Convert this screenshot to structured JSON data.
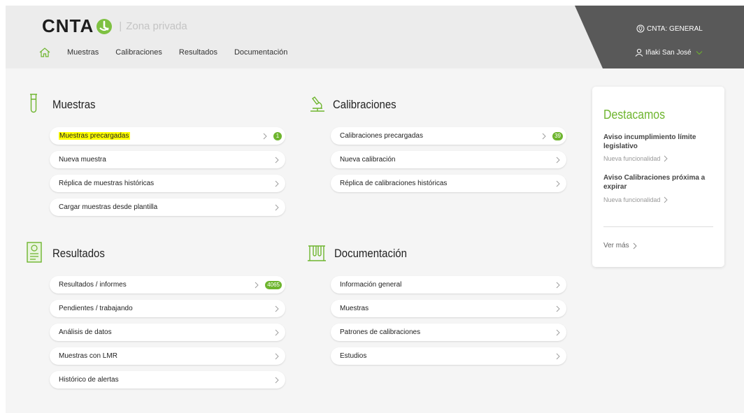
{
  "header": {
    "logo_text": "CNTA",
    "logo_separator": "|",
    "zone": "Zona privada",
    "nav": [
      "Muestras",
      "Calibraciones",
      "Resultados",
      "Documentación"
    ],
    "center": "CNTA: GENERAL",
    "user": "Iñaki San José"
  },
  "sections": {
    "muestras": {
      "title": "Muestras",
      "items": [
        {
          "label": "Muestras precargadas",
          "badge": "1"
        },
        {
          "label": "Nueva muestra"
        },
        {
          "label": "Réplica de muestras históricas"
        },
        {
          "label": "Cargar muestras desde plantilla"
        }
      ]
    },
    "calibraciones": {
      "title": "Calibraciones",
      "items": [
        {
          "label": "Calibraciones precargadas",
          "badge": "39"
        },
        {
          "label": "Nueva calibración"
        },
        {
          "label": "Réplica de calibraciones históricas"
        }
      ]
    },
    "resultados": {
      "title": "Resultados",
      "items": [
        {
          "label": "Resultados / informes",
          "badge": "4065"
        },
        {
          "label": "Pendientes / trabajando"
        },
        {
          "label": "Análisis de datos"
        },
        {
          "label": "Muestras con LMR"
        },
        {
          "label": "Histórico de alertas"
        }
      ]
    },
    "documentacion": {
      "title": "Documentación",
      "items": [
        {
          "label": "Información general"
        },
        {
          "label": "Muestras"
        },
        {
          "label": "Patrones de calibraciones"
        },
        {
          "label": "Estudios"
        }
      ]
    }
  },
  "destacamos": {
    "title": "Destacamos",
    "items": [
      {
        "title": "Aviso incumplimiento límite legislativo",
        "sub": "Nueva funcionalidad"
      },
      {
        "title": "Aviso Calibraciones próxima a expirar",
        "sub": "Nueva funcionalidad"
      }
    ],
    "ver_mas": "Ver más"
  },
  "colors": {
    "accent": "#6eb52e",
    "header_dark": "#595959",
    "highlight": "#ffff00"
  }
}
